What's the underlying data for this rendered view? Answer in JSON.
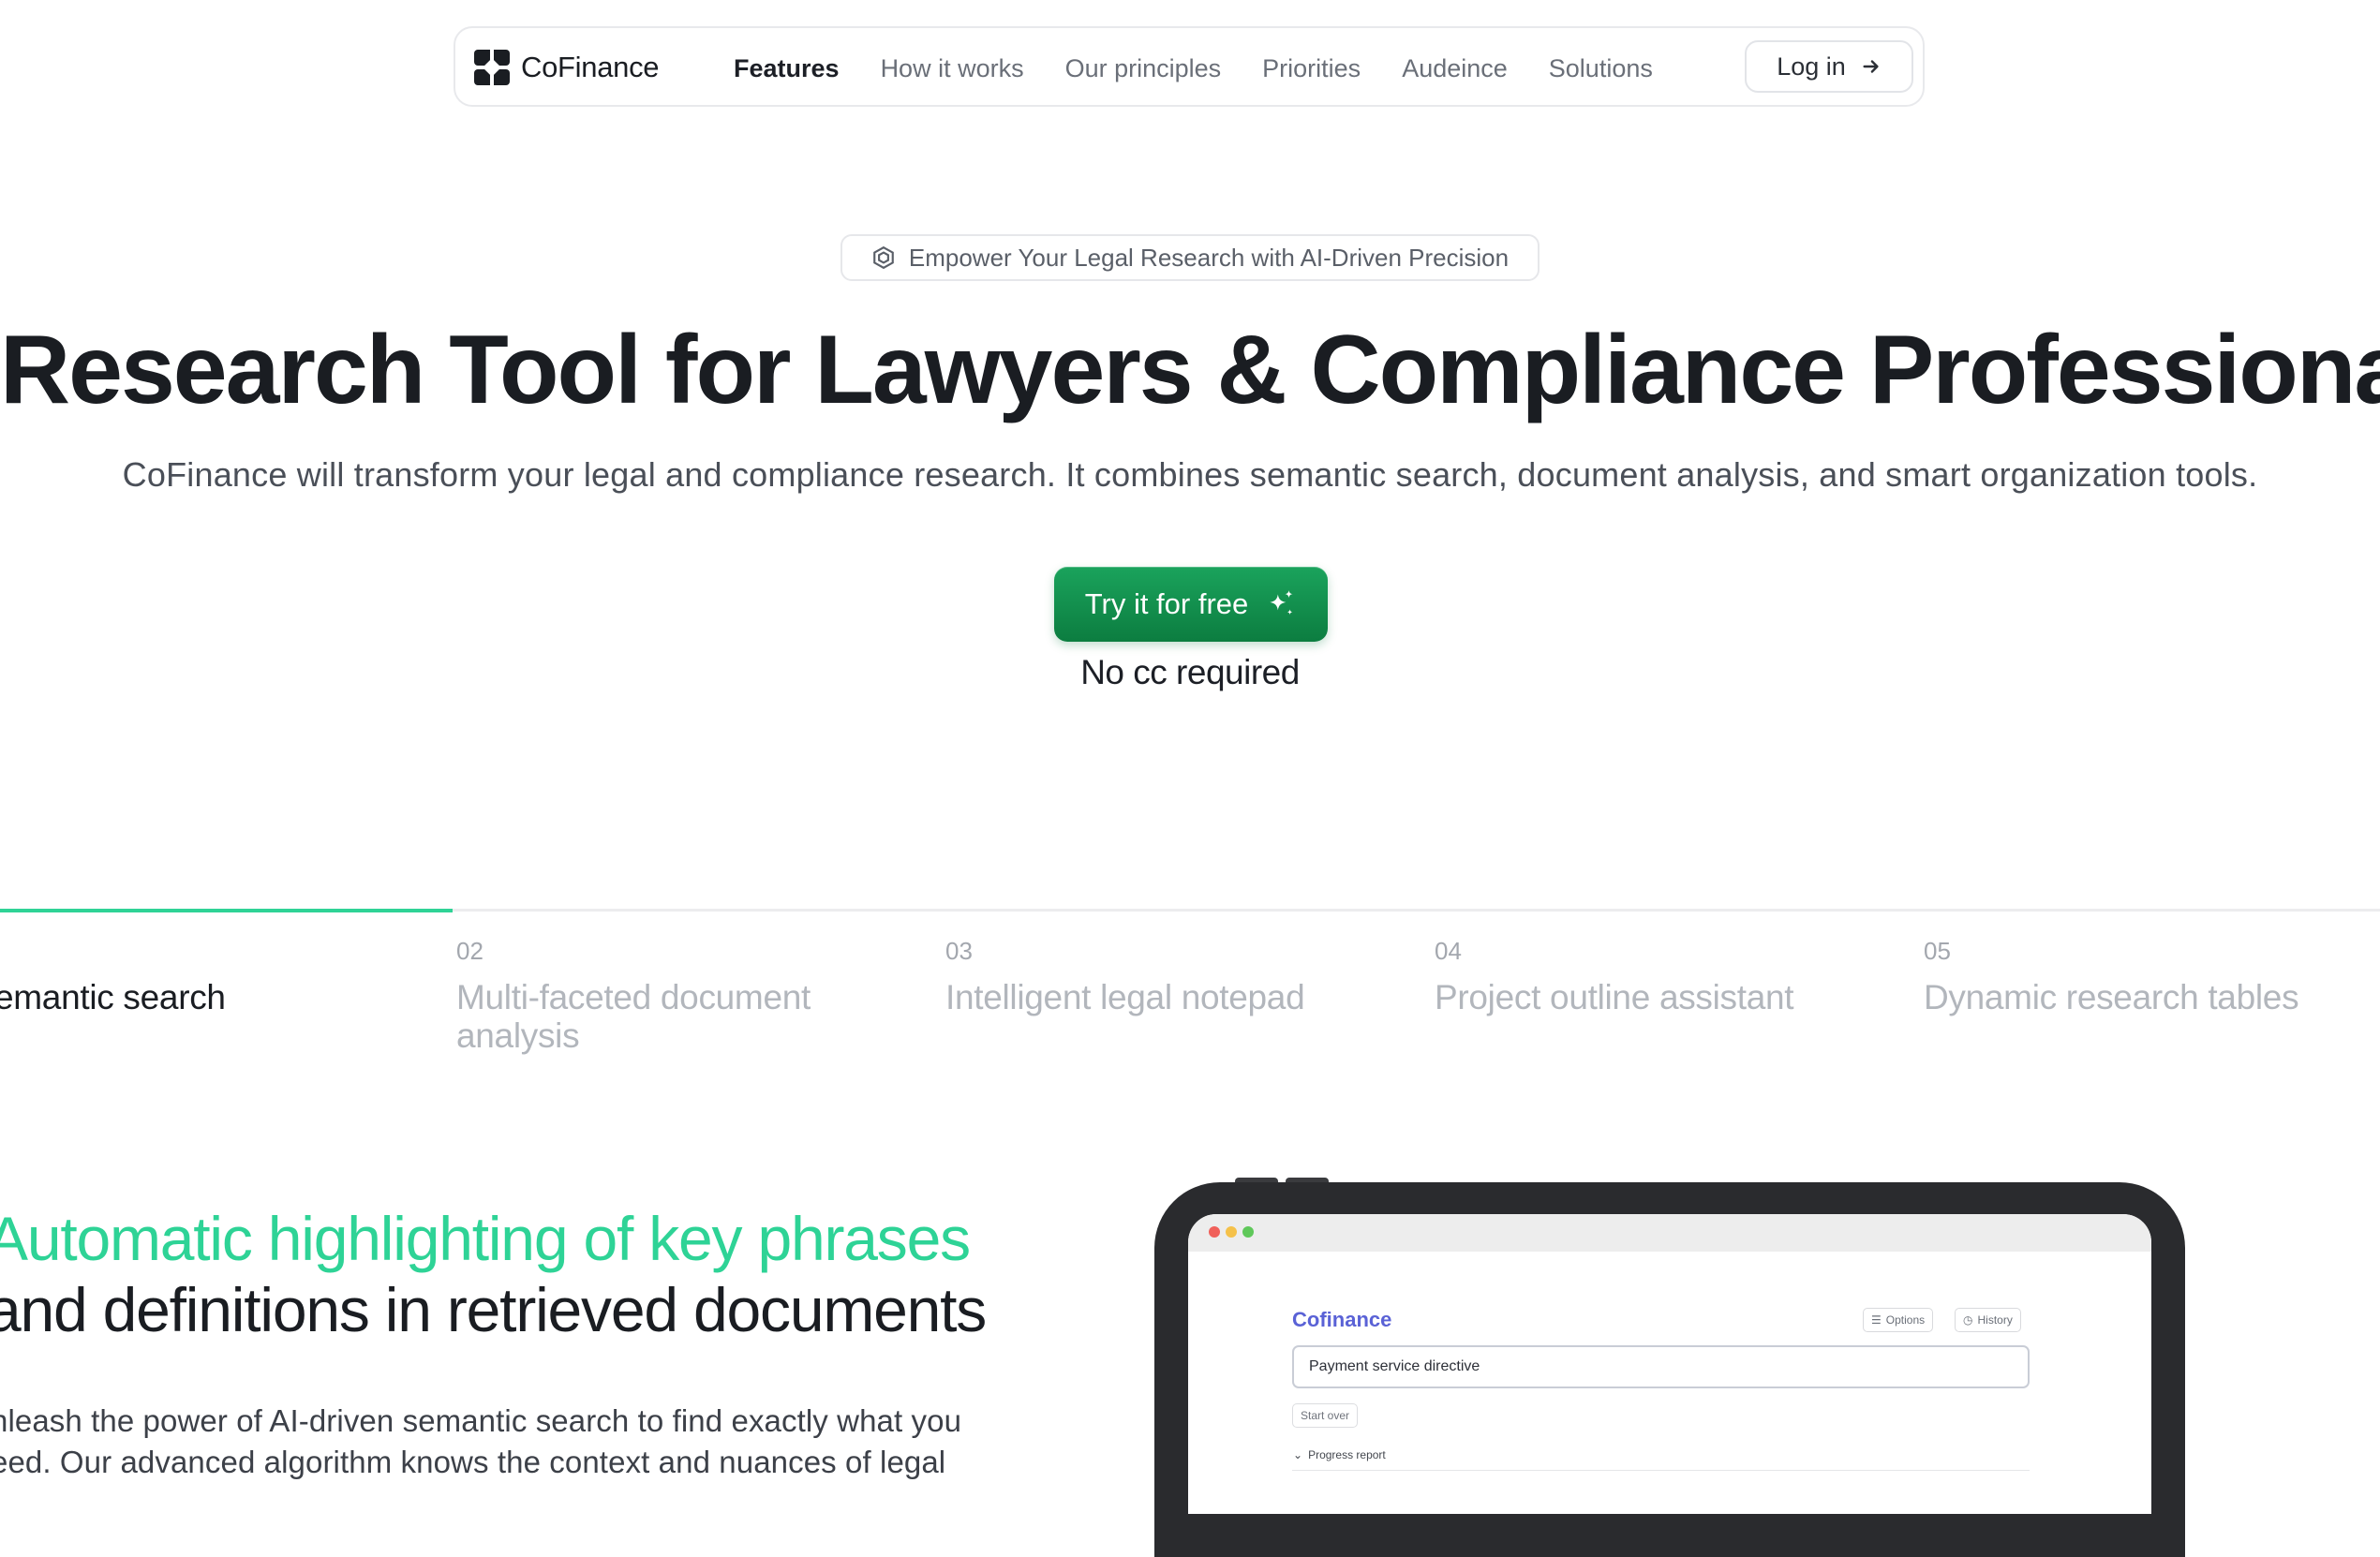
{
  "nav": {
    "brand": "CoFinance",
    "links": [
      "Features",
      "How it works",
      "Our principles",
      "Priorities",
      "Audeince",
      "Solutions"
    ],
    "active_link": "Features",
    "login_label": "Log in"
  },
  "hero": {
    "badge": "Empower Your Legal Research with AI-Driven Precision",
    "title": "Research Tool for Lawyers & Compliance Professionals",
    "subtitle": "CoFinance will transform your legal and compliance research. It combines semantic search, document analysis, and smart organization tools.",
    "cta_label": "Try it for free",
    "cta_note": "No cc required"
  },
  "features": {
    "tabs": [
      {
        "num": "",
        "label": "emantic search"
      },
      {
        "num": "02",
        "label": "Multi-faceted document analysis"
      },
      {
        "num": "03",
        "label": "Intelligent legal notepad"
      },
      {
        "num": "04",
        "label": "Project outline assistant"
      },
      {
        "num": "05",
        "label": "Dynamic research tables"
      }
    ],
    "active_tab_progress": 0.19,
    "heading_highlight": "Automatic highlighting of key phrases",
    "heading_rest": "and definitions in retrieved documents",
    "body": "nleash the power of AI-driven semantic search to find exactly what you eed. Our advanced algorithm knows the context and nuances of legal"
  },
  "mockup": {
    "app_title": "Cofinance",
    "options_label": "Options",
    "history_label": "History",
    "search_value": "Payment service directive",
    "start_over_label": "Start over",
    "progress_report_label": "Progress report"
  },
  "colors": {
    "accent_green": "#2ed396",
    "cta_green": "#0f8a48",
    "mockup_brand": "#5a62d6",
    "text_dark": "#1a1d22"
  }
}
